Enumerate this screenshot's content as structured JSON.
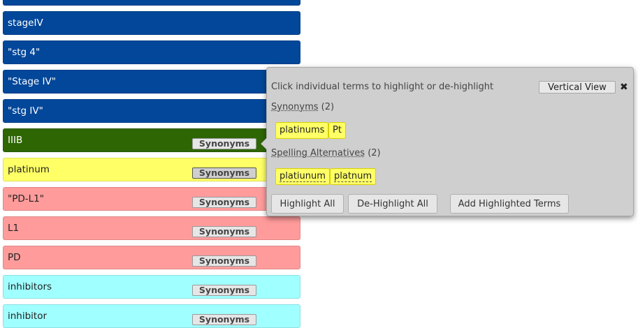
{
  "terms": [
    {
      "label": "",
      "color": "#02479a",
      "text_color": "#ffffff",
      "has_button": false
    },
    {
      "label": "stageIV",
      "color": "#02479a",
      "text_color": "#ffffff",
      "has_button": false
    },
    {
      "label": "\"stg 4\"",
      "color": "#02479a",
      "text_color": "#ffffff",
      "has_button": false
    },
    {
      "label": "\"Stage IV\"",
      "color": "#02479a",
      "text_color": "#ffffff",
      "has_button": false
    },
    {
      "label": "\"stg IV\"",
      "color": "#02479a",
      "text_color": "#ffffff",
      "has_button": false
    },
    {
      "label": "IIIB",
      "color": "#2e6603",
      "text_color": "#ffffff",
      "has_button": true
    },
    {
      "label": "platinum",
      "color": "#ffff66",
      "text_color": "#222222",
      "has_button": true,
      "active": true
    },
    {
      "label": "\"PD-L1\"",
      "color": "#ff9b9b",
      "text_color": "#222222",
      "has_button": true
    },
    {
      "label": "L1",
      "color": "#ff9b9b",
      "text_color": "#222222",
      "has_button": true
    },
    {
      "label": "PD",
      "color": "#ff9b9b",
      "text_color": "#222222",
      "has_button": true
    },
    {
      "label": "inhibitors",
      "color": "#a0ffff",
      "text_color": "#222222",
      "has_button": true
    },
    {
      "label": "inhibitor",
      "color": "#a0ffff",
      "text_color": "#222222",
      "has_button": true
    }
  ],
  "synonyms_button_label": "Synonyms",
  "popover": {
    "instruction": "Click individual terms to highlight or de-highlight",
    "vertical_view_label": "Vertical View",
    "close_label": "✖",
    "synonyms_heading": "Synonyms",
    "synonyms_count": "(2)",
    "synonyms": [
      "platinums",
      "Pt"
    ],
    "spelling_heading": "Spelling Alternatives",
    "spelling_count": "(2)",
    "spelling": [
      "platiunum",
      "platnum"
    ],
    "highlight_all_label": "Highlight All",
    "dehighlight_all_label": "De-Highlight All",
    "add_terms_label": "Add Highlighted Terms",
    "chip_color": "#ffff66"
  }
}
